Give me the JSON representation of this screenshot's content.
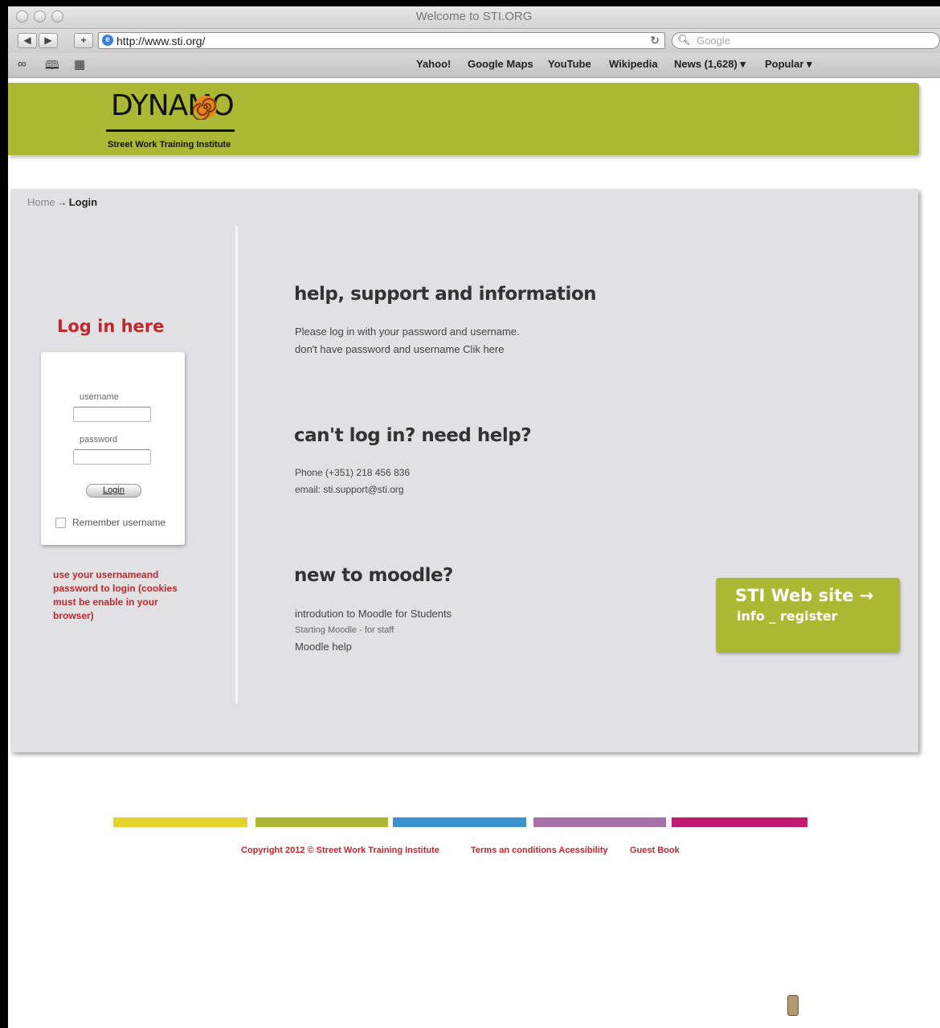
{
  "browser": {
    "window_title": "Welcome to STI.ORG",
    "url": "http://www.sti.org/",
    "search_placeholder": "Google",
    "back_label": "◀",
    "forward_label": "▶",
    "add_label": "+",
    "reload_label": "↻",
    "bookmarks": [
      "Yahoo!",
      "Google Maps",
      "YouTube",
      "Wikipedia",
      "News (1,628) ▾",
      "Popular ▾"
    ]
  },
  "header": {
    "logo_text": "DYNAMO",
    "logo_tagline": "Street Work Training Institute",
    "logo_color": "#abb833"
  },
  "breadcrumb": {
    "home": "Home",
    "arrow": "→",
    "current": "Login"
  },
  "login": {
    "heading": "Log in here",
    "username_label": "username",
    "password_label": "password",
    "button_label": "Login",
    "remember_label": "Remember username",
    "note": "use your usernameand password to login (cookies must be enable in your browser)"
  },
  "sections": [
    {
      "title": "help, support and information",
      "lines": [
        "Please log in with your password and username.",
        "don't have password and username Clik here"
      ]
    },
    {
      "title": "can't log in? need help?",
      "lines": [
        "Phone (+351) 218 456 836",
        "email: sti.support@sti.org"
      ]
    },
    {
      "title": "new to moodle?",
      "lines": [
        "introdution to Moodle for Students",
        "Starting Moodle - for staff",
        "Moodle help"
      ]
    }
  ],
  "cta": {
    "line1": "STI Web site →",
    "line2": "info _ register"
  },
  "color_strip": [
    "#e6d22a",
    "#abb833",
    "#3a93cf",
    "#a870a8",
    "#c01b6e"
  ],
  "footer": {
    "copyright": "Copyright 2012 © Street Work Training Institute",
    "terms": "Terms an conditions Acessibility",
    "guestbook": "Guest Book"
  }
}
